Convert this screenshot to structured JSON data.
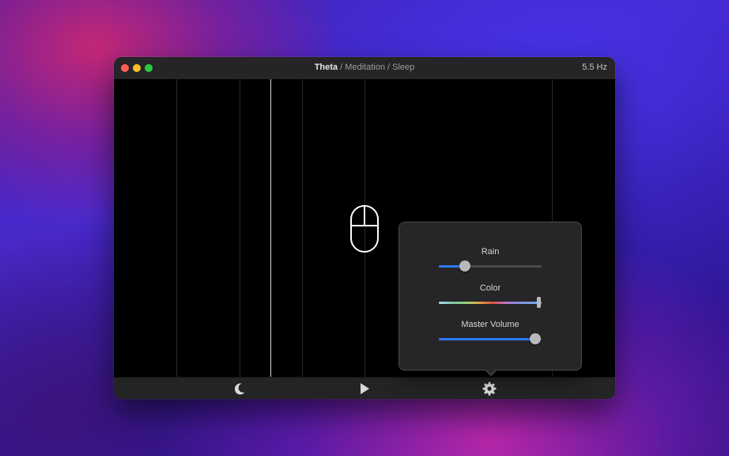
{
  "window": {
    "title_primary": "Theta",
    "title_secondary": " / Meditation / Sleep",
    "frequency": "5.5 Hz"
  },
  "icons": {
    "close": "close-traffic-light",
    "minimize": "minimize-traffic-light",
    "maximize": "maximize-traffic-light",
    "mouse": "mouse-icon",
    "moon": "moon-icon",
    "play": "play-icon",
    "gear": "gear-icon"
  },
  "popover": {
    "rain": {
      "label": "Rain",
      "value": 0.25
    },
    "color": {
      "label": "Color",
      "value": 0.97
    },
    "master_volume": {
      "label": "Master Volume",
      "value": 0.94
    }
  },
  "colors": {
    "accent": "#2f7bf6",
    "titlebar": "#262427",
    "canvas": "#000000"
  }
}
